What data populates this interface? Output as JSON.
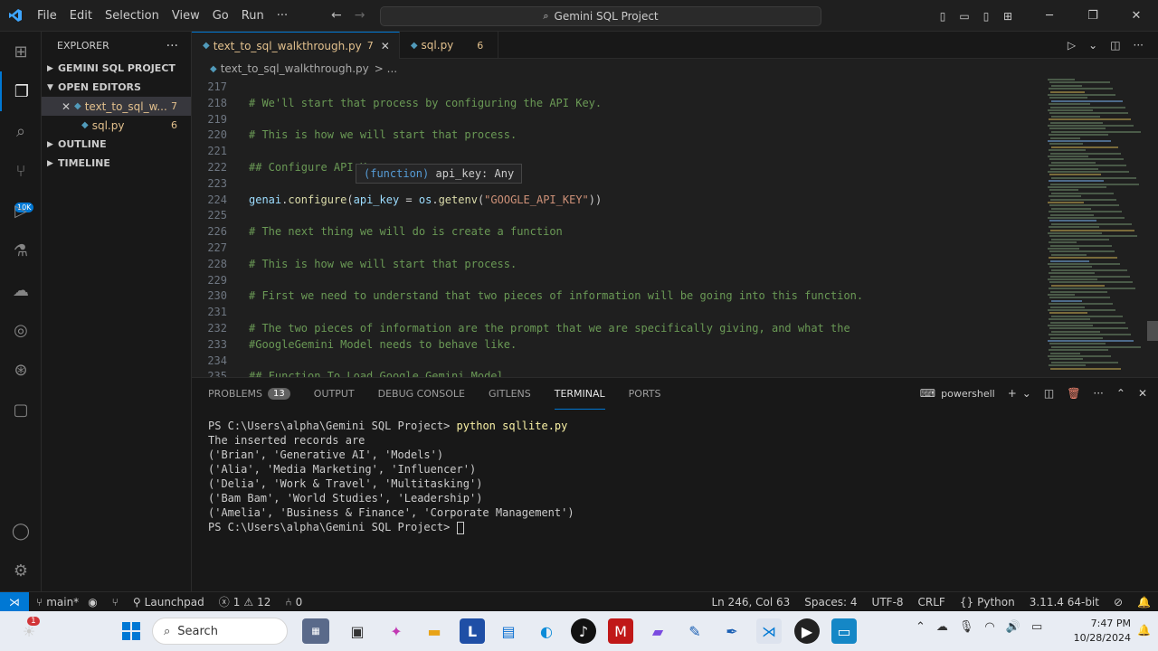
{
  "titlebar": {
    "menus": [
      "File",
      "Edit",
      "Selection",
      "View",
      "Go",
      "Run",
      "···"
    ],
    "search_text": "Gemini SQL Project"
  },
  "explorer": {
    "title": "EXPLORER",
    "project": "GEMINI SQL PROJECT",
    "open_editors": "OPEN EDITORS",
    "files": [
      {
        "name": "text_to_sql_w...",
        "count": "7"
      },
      {
        "name": "sql.py",
        "count": "6"
      }
    ],
    "outline": "OUTLINE",
    "timeline": "TIMELINE",
    "ext_badge": "10K"
  },
  "tabs": [
    {
      "name": "text_to_sql_walkthrough.py",
      "count": "7"
    },
    {
      "name": "sql.py",
      "count": "6"
    }
  ],
  "breadcrumb": {
    "file": "text_to_sql_walkthrough.py",
    "rest": "> ..."
  },
  "editor": {
    "lines": [
      {
        "n": "217",
        "parts": []
      },
      {
        "n": "218",
        "parts": [
          {
            "c": "cm",
            "t": "# We'll start that process by configuring the API Key."
          }
        ]
      },
      {
        "n": "219",
        "parts": []
      },
      {
        "n": "220",
        "parts": [
          {
            "c": "cm",
            "t": "# This is how we will start that process."
          }
        ]
      },
      {
        "n": "221",
        "parts": []
      },
      {
        "n": "222",
        "parts": [
          {
            "c": "cm",
            "t": "## Configure API Key"
          }
        ]
      },
      {
        "n": "223",
        "parts": []
      },
      {
        "n": "224",
        "parts": [
          {
            "c": "vr",
            "t": "genai"
          },
          {
            "c": "pl",
            "t": "."
          },
          {
            "c": "fn",
            "t": "configure"
          },
          {
            "c": "pl",
            "t": "("
          },
          {
            "c": "vr",
            "t": "api_key"
          },
          {
            "c": "pl",
            "t": " = "
          },
          {
            "c": "vr",
            "t": "os"
          },
          {
            "c": "pl",
            "t": "."
          },
          {
            "c": "fn",
            "t": "getenv"
          },
          {
            "c": "pl",
            "t": "("
          },
          {
            "c": "st",
            "t": "\"GOOGLE_API_KEY\""
          },
          {
            "c": "pl",
            "t": "))"
          }
        ]
      },
      {
        "n": "225",
        "parts": []
      },
      {
        "n": "226",
        "parts": [
          {
            "c": "cm",
            "t": "# The next thing we will do is create a function"
          }
        ]
      },
      {
        "n": "227",
        "parts": []
      },
      {
        "n": "228",
        "parts": [
          {
            "c": "cm",
            "t": "# This is how we will start that process."
          }
        ]
      },
      {
        "n": "229",
        "parts": []
      },
      {
        "n": "230",
        "parts": [
          {
            "c": "cm",
            "t": "# First we need to understand that two pieces of information will be going into this function."
          }
        ]
      },
      {
        "n": "231",
        "parts": []
      },
      {
        "n": "232",
        "parts": [
          {
            "c": "cm",
            "t": "# The two pieces of information are the prompt that we are specifically giving, and what the"
          }
        ]
      },
      {
        "n": "233",
        "parts": [
          {
            "c": "cm",
            "t": "#GoogleGemini Model needs to behave like."
          }
        ]
      },
      {
        "n": "234",
        "parts": []
      },
      {
        "n": "235",
        "parts": [
          {
            "c": "cm",
            "t": "## Function To Load Google Gemini Model"
          }
        ]
      }
    ],
    "hover_kw": "(function)",
    "hover_rest": " api_key: Any"
  },
  "panel": {
    "tabs": [
      "PROBLEMS",
      "OUTPUT",
      "DEBUG CONSOLE",
      "GITLENS",
      "TERMINAL",
      "PORTS"
    ],
    "problems_count": "13",
    "shell": "powershell",
    "terminal": {
      "prompt1": "PS C:\\Users\\alpha\\Gemini SQL Project> ",
      "cmd1": "python sqllite.py",
      "output": [
        "The inserted records are",
        "('Brian', 'Generative AI', 'Models')",
        "('Alia', 'Media Marketing', 'Influencer')",
        "('Delia', 'Work & Travel', 'Multitasking')",
        "('Bam Bam', 'World Studies', 'Leadership')",
        "('Amelia', 'Business & Finance', 'Corporate Management')"
      ],
      "prompt2": "PS C:\\Users\\alpha\\Gemini SQL Project> "
    }
  },
  "statusbar": {
    "branch": "main*",
    "launchpad": "Launchpad",
    "errors": "1",
    "warnings": "12",
    "ports": "0",
    "position": "Ln 246, Col 63",
    "spaces": "Spaces: 4",
    "encoding": "UTF-8",
    "eol": "CRLF",
    "language": "Python",
    "interpreter": "3.11.4 64-bit"
  },
  "taskbar": {
    "search": "Search",
    "time": "7:47 PM",
    "date": "10/28/2024",
    "notif_badge": "1"
  }
}
